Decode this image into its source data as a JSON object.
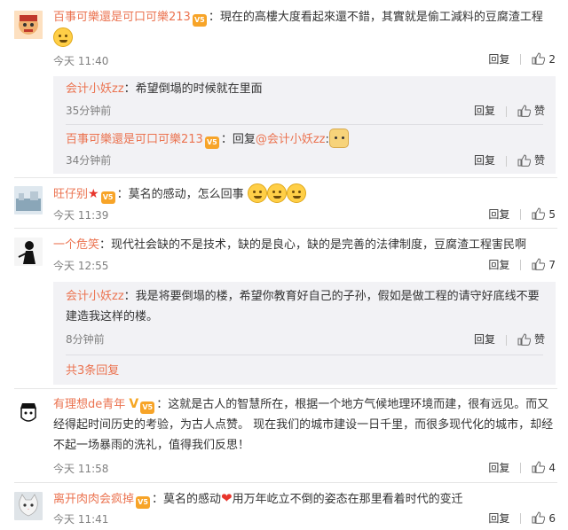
{
  "comments": [
    {
      "user": "百事可樂還是可口可樂213",
      "text": "：現在的高樓大度看起來還不錯，其實就是偷工減料的豆腐渣工程",
      "time": "今天 11:40",
      "reply": "回复",
      "likes": "2"
    },
    {
      "user": "旺仔别",
      "text": "：莫名的感动，怎么回事",
      "time": "今天 11:39",
      "reply": "回复",
      "likes": "5"
    },
    {
      "user": "一个危笑",
      "text": "：现代社会缺的不是技术，缺的是良心，缺的是完善的法律制度，豆腐渣工程害民啊",
      "time": "今天 12:55",
      "reply": "回复",
      "likes": "7"
    },
    {
      "user": "有理想de青年",
      "text": "：这就是古人的智慧所在，根据一个地方气候地理环境而建，很有远见。而又经得起时间历史的考验，为古人点赞。 现在我们的城市建设一日千里，而很多现代化的城市，却经不起一场暴雨的洗礼，值得我们反思！",
      "time": "今天 11:58",
      "reply": "回复",
      "likes": "4"
    },
    {
      "user": "离开肉肉会疯掉",
      "text": "：莫名的感动",
      "text2": "用万年屹立不倒的姿态在那里看着时代的变迁",
      "time": "今天 11:41",
      "reply": "回复",
      "likes": "6"
    }
  ],
  "subreplies": [
    {
      "user": "会计小妖zz",
      "text": "：希望倒塌的时候就在里面",
      "time": "35分钟前",
      "reply": "回复",
      "like": "赞"
    },
    {
      "user": "百事可樂還是可口可樂213",
      "text": "：回复",
      "mention": "@会计小妖zz",
      "colon": ":",
      "time": "34分钟前",
      "reply": "回复",
      "like": "赞"
    },
    {
      "user": "会计小妖zz",
      "text": "：我是将要倒塌的楼，希望你教育好自己的子孙，假如是做工程的请守好底线不要建造我这样的楼。",
      "time": "8分钟前",
      "reply": "回复",
      "like": "赞"
    }
  ],
  "more_replies": "共3条回复",
  "colors": {
    "username": "#eb7350",
    "subbg": "#f2f2f5",
    "time": "#808080"
  }
}
